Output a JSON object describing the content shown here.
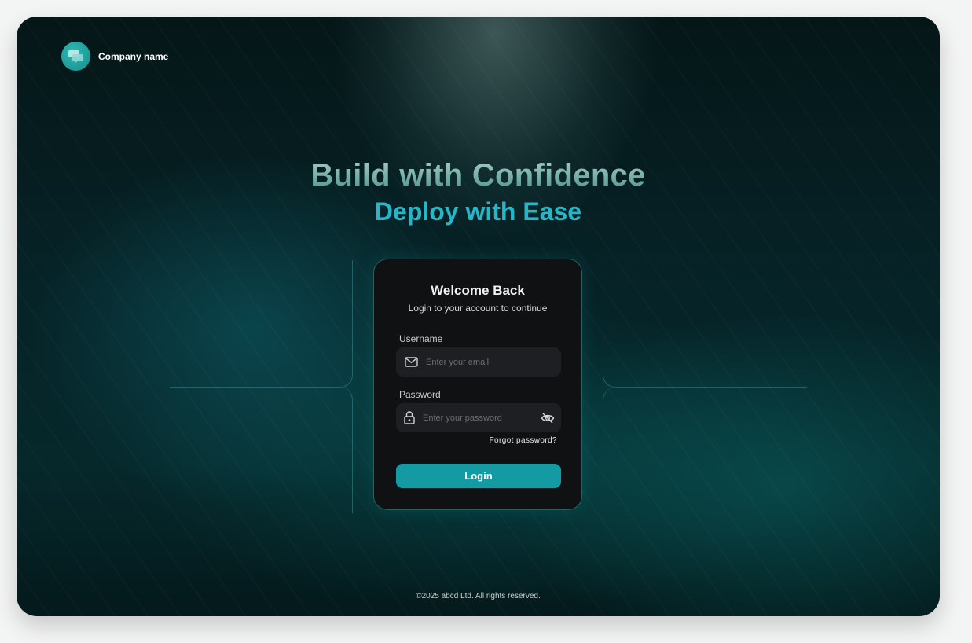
{
  "brand": {
    "company_name": "Company name",
    "logo_icon": "chat-bubbles-icon",
    "accent": "#1a9e9a"
  },
  "hero": {
    "title": "Build with Confidence",
    "subtitle": "Deploy with Ease"
  },
  "login_card": {
    "title": "Welcome Back",
    "subtitle": "Login to your account to continue",
    "username": {
      "label": "Username",
      "placeholder": "Enter your email",
      "value": "",
      "icon": "mail-icon"
    },
    "password": {
      "label": "Password",
      "placeholder": "Enter your password",
      "value": "",
      "icon": "lock-icon",
      "toggle_icon": "eye-off-icon"
    },
    "forgot_password": "Forgot password?",
    "login_button": "Login",
    "button_color": "#139aa3"
  },
  "footer": {
    "copyright": "©2025 abcd Ltd. All rights reserved."
  }
}
